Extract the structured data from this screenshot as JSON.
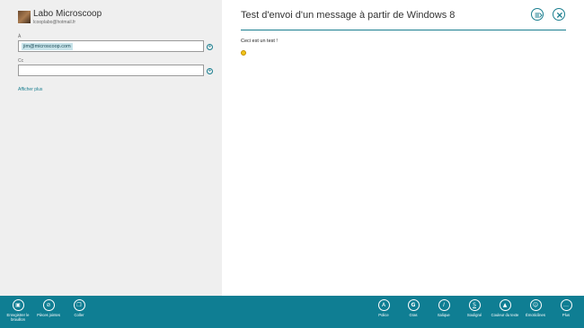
{
  "account": {
    "name": "Labo Microscoop",
    "email": "lcooplabo@hotmail.fr"
  },
  "compose": {
    "to_label": "À",
    "to_recipients": [
      "jim@microscoop.com"
    ],
    "cc_label": "Cc",
    "cc_value": "",
    "show_more": "Afficher plus",
    "subject": "Test d'envoi d'un message à partir de Windows 8",
    "body_line": "Ceci est un test !",
    "body_emoji": "smiley-emoji"
  },
  "colors": {
    "accent": "#0f7e93",
    "left_pane": "#efefef"
  },
  "appbar": {
    "left": [
      {
        "icon": "save-icon",
        "label": "Enregistrer le brouillon"
      },
      {
        "icon": "attachment-icon",
        "label": "Pièces jointes"
      },
      {
        "icon": "paste-icon",
        "label": "Coller"
      }
    ],
    "right": [
      {
        "icon": "font-icon",
        "label": "Police"
      },
      {
        "icon": "bold-icon",
        "label": "Gras"
      },
      {
        "icon": "italic-icon",
        "label": "Italique"
      },
      {
        "icon": "underline-icon",
        "label": "Souligné"
      },
      {
        "icon": "text-color-icon",
        "label": "Couleur du texte"
      },
      {
        "icon": "emoticons-icon",
        "label": "Émoticônes"
      },
      {
        "icon": "more-icon",
        "label": "Plus"
      }
    ]
  }
}
